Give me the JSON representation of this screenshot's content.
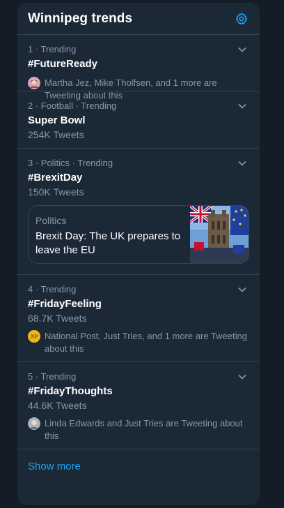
{
  "header": {
    "title": "Winnipeg trends",
    "settings_icon": "gear-icon"
  },
  "trends": [
    {
      "meta": "1 · Trending",
      "name": "#FutureReady",
      "count": "",
      "social": "Martha Jez, Mike Tholfsen, and 1 more are Tweeting about this"
    },
    {
      "meta": "2 · Football · Trending",
      "name": "Super Bowl",
      "count": "254K Tweets"
    },
    {
      "meta": "3 · Politics · Trending",
      "name": "#BrexitDay",
      "count": "150K Tweets",
      "card": {
        "category": "Politics",
        "headline": "Brexit Day: The UK prepares to leave the EU"
      }
    },
    {
      "meta": "4 · Trending",
      "name": "#FridayFeeling",
      "count": "68.7K Tweets",
      "social": "National Post, Just Tries, and 1 more are Tweeting about this",
      "avatar_text": "NP"
    },
    {
      "meta": "5 · Trending",
      "name": "#FridayThoughts",
      "count": "44.6K Tweets",
      "social": "Linda Edwards and Just Tries are Tweeting about this"
    }
  ],
  "footer": {
    "show_more": "Show more"
  },
  "colors": {
    "background": "#141d26",
    "panel": "#1b2836",
    "accent": "#1da1f2",
    "muted_text": "#8899a6",
    "divider": "#38444d"
  }
}
